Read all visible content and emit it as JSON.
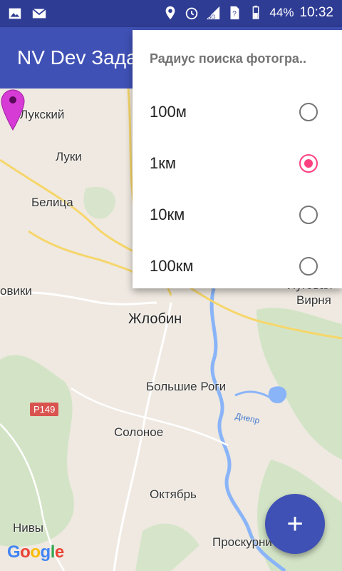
{
  "status_bar": {
    "battery": "44%",
    "time": "10:32",
    "network": "3G",
    "icons": [
      "image-icon",
      "mail-icon",
      "location-icon",
      "alarm-icon",
      "signal-icon",
      "sim-unknown-icon",
      "battery-icon"
    ]
  },
  "app_bar": {
    "title": "NV Dev Зада"
  },
  "popup_menu": {
    "header": "Радиус поиска фотогра..",
    "options": [
      {
        "label": "100м",
        "checked": false
      },
      {
        "label": "1км",
        "checked": true
      },
      {
        "label": "10км",
        "checked": false
      },
      {
        "label": "100км",
        "checked": false
      }
    ]
  },
  "map": {
    "places": [
      "Лукский",
      "Луки",
      "Белица",
      "овики",
      "Жлобин",
      "Большие Роги",
      "Солоное",
      "Октябрь",
      "Нивы",
      "Проскурни",
      "Вирня",
      "Луговая"
    ],
    "road_badge": "P149",
    "river": "Днепр",
    "attribution": [
      "G",
      "o",
      "o",
      "g",
      "l",
      "e"
    ]
  },
  "fab": {
    "icon": "plus-icon",
    "symbol": "+"
  },
  "colors": {
    "primary": "#3f51b5",
    "primary_dark": "#2f3c94",
    "accent": "#ff4081"
  }
}
